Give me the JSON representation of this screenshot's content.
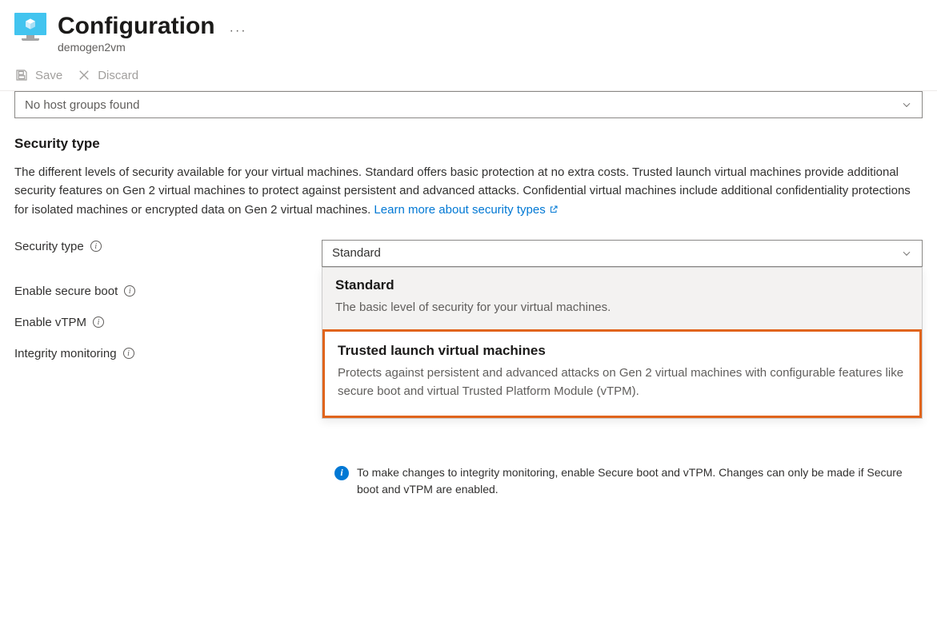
{
  "header": {
    "title": "Configuration",
    "subtitle": "demogen2vm"
  },
  "toolbar": {
    "save": "Save",
    "discard": "Discard"
  },
  "hostGroup": {
    "placeholder": "No host groups found"
  },
  "section": {
    "title": "Security type",
    "description": "The different levels of security available for your virtual machines. Standard offers basic protection at no extra costs. Trusted launch virtual machines provide additional security features on Gen 2 virtual machines to protect against persistent and advanced attacks. Confidential virtual machines include additional confidentiality protections for isolated machines or encrypted data on Gen 2 virtual machines. ",
    "learnMore": "Learn more about security types"
  },
  "fields": {
    "securityType": {
      "label": "Security type",
      "value": "Standard"
    },
    "secureBoot": {
      "label": "Enable secure boot"
    },
    "vtpm": {
      "label": "Enable vTPM"
    },
    "integrity": {
      "label": "Integrity monitoring"
    }
  },
  "options": {
    "standard": {
      "title": "Standard",
      "desc": "The basic level of security for your virtual machines."
    },
    "trusted": {
      "title": "Trusted launch virtual machines",
      "desc": "Protects against persistent and advanced attacks on Gen 2 virtual machines with configurable features like secure boot and virtual Trusted Platform Module (vTPM)."
    }
  },
  "callout": {
    "text": "To make changes to integrity monitoring, enable Secure boot and vTPM. Changes can only be made if Secure boot and vTPM are enabled."
  }
}
